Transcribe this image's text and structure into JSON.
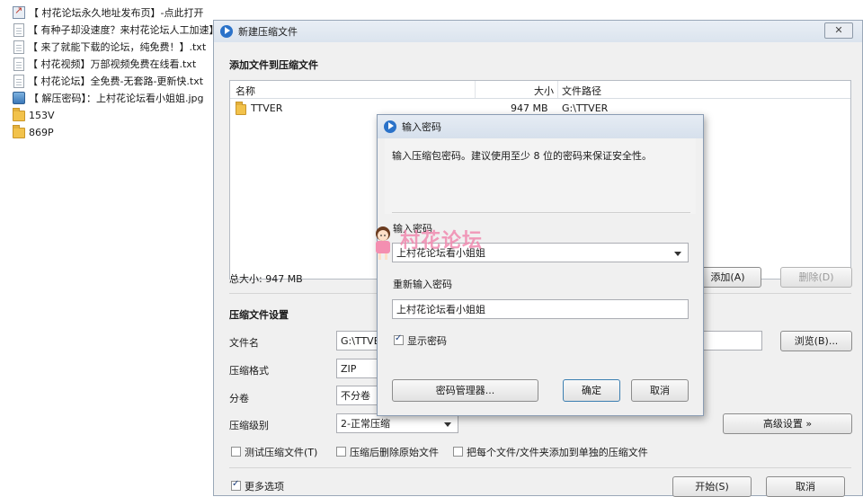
{
  "desktop": {
    "files": [
      {
        "name": "【 村花论坛永久地址发布页】-点此打开",
        "icon": "shortcut-icon"
      },
      {
        "name": "【 有种子却没速度？来村花论坛人工加速】",
        "icon": "text-file-icon"
      },
      {
        "name": "【 来了就能下载的论坛，纯免费！】.txt",
        "icon": "text-file-icon"
      },
      {
        "name": "【 村花视频】万部视频免费在线看.txt",
        "icon": "text-file-icon"
      },
      {
        "name": "【 村花论坛】全免费-无套路-更新快.txt",
        "icon": "text-file-icon"
      },
      {
        "name": "【 解压密码】：上村花论坛看小姐姐.jpg",
        "icon": "image-file-icon"
      },
      {
        "name": "153V",
        "icon": "folder-icon"
      },
      {
        "name": "869P",
        "icon": "folder-icon"
      }
    ]
  },
  "main_dialog": {
    "title": "新建压缩文件",
    "close_label": "✕",
    "add_section_title": "添加文件到压缩文件",
    "table": {
      "columns": [
        "名称",
        "大小",
        "文件路径"
      ],
      "rows": [
        {
          "name": "TTVER",
          "size": "947 MB",
          "path": "G:\\TTVER"
        }
      ]
    },
    "total_size": "总大小: 947 MB",
    "add_button": "添加(A)",
    "delete_button": "删除(D)",
    "settings_title": "压缩文件设置",
    "filename_label": "文件名",
    "filename_value": "G:\\TTVER",
    "browse_button": "浏览(B)...",
    "format_label": "压缩格式",
    "format_value": "ZIP",
    "split_label": "分卷",
    "split_value": "不分卷",
    "level_label": "压缩级别",
    "level_value": "2-正常压缩",
    "advanced_button": "高级设置 »",
    "option_test": "测试压缩文件(T)",
    "option_delete": "压缩后删除原始文件",
    "option_separate": "把每个文件/文件夹添加到单独的压缩文件",
    "more_options": "更多选项",
    "start_button": "开始(S)",
    "cancel_button": "取消"
  },
  "password_dialog": {
    "title": "输入密码",
    "description": "输入压缩包密码。建议使用至少 8 位的密码来保证安全性。",
    "enter_label": "输入密码",
    "enter_value": "上村花论坛看小姐姐",
    "reenter_label": "重新输入密码",
    "reenter_value": "上村花论坛看小姐姐",
    "show_password": "显示密码",
    "show_password_checked": true,
    "manager_button": "密码管理器...",
    "ok_button": "确定",
    "cancel_button": "取消"
  },
  "watermark": {
    "text": "村花论坛"
  }
}
